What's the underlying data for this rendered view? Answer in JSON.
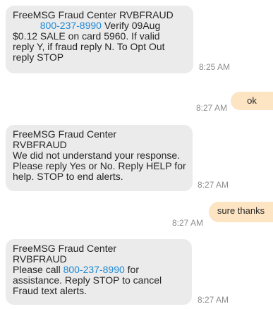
{
  "messages": [
    {
      "direction": "incoming",
      "lines": [
        {
          "parts": [
            "FreeMSG Fraud Center RVBFRAUD"
          ]
        },
        {
          "parts": [
            "",
            "800-237-8990",
            " Verify 09Aug"
          ]
        },
        {
          "parts": [
            "$0.12 SALE on card 5960. If valid"
          ]
        },
        {
          "parts": [
            "reply Y, if fraud reply N. To Opt Out"
          ]
        },
        {
          "parts": [
            "reply STOP"
          ]
        }
      ],
      "time": "8:25 AM"
    },
    {
      "direction": "outgoing",
      "text": "ok",
      "time": "8:27 AM"
    },
    {
      "direction": "incoming",
      "lines": [
        {
          "parts": [
            "FreeMSG Fraud Center"
          ]
        },
        {
          "parts": [
            "RVBFRAUD"
          ]
        },
        {
          "parts": [
            "We did not understand your response."
          ]
        },
        {
          "parts": [
            "Please reply Yes or No. Reply HELP for"
          ]
        },
        {
          "parts": [
            "help. STOP to end alerts."
          ]
        }
      ],
      "time": "8:27 AM"
    },
    {
      "direction": "outgoing",
      "text": "sure thanks",
      "time": "8:27 AM"
    },
    {
      "direction": "incoming",
      "lines": [
        {
          "parts": [
            "FreeMSG Fraud Center"
          ]
        },
        {
          "parts": [
            "RVBFRAUD"
          ]
        },
        {
          "parts": [
            "Please call ",
            "800-237-8990",
            " for"
          ]
        },
        {
          "parts": [
            "assistance. Reply STOP to cancel"
          ]
        },
        {
          "parts": [
            "Fraud text alerts."
          ]
        }
      ],
      "time": "8:27 AM"
    }
  ],
  "colors": {
    "incoming_bubble": "#ebebeb",
    "outgoing_bubble": "#fde5c3",
    "link": "#1e88d6",
    "timestamp": "#8d8d8d"
  }
}
